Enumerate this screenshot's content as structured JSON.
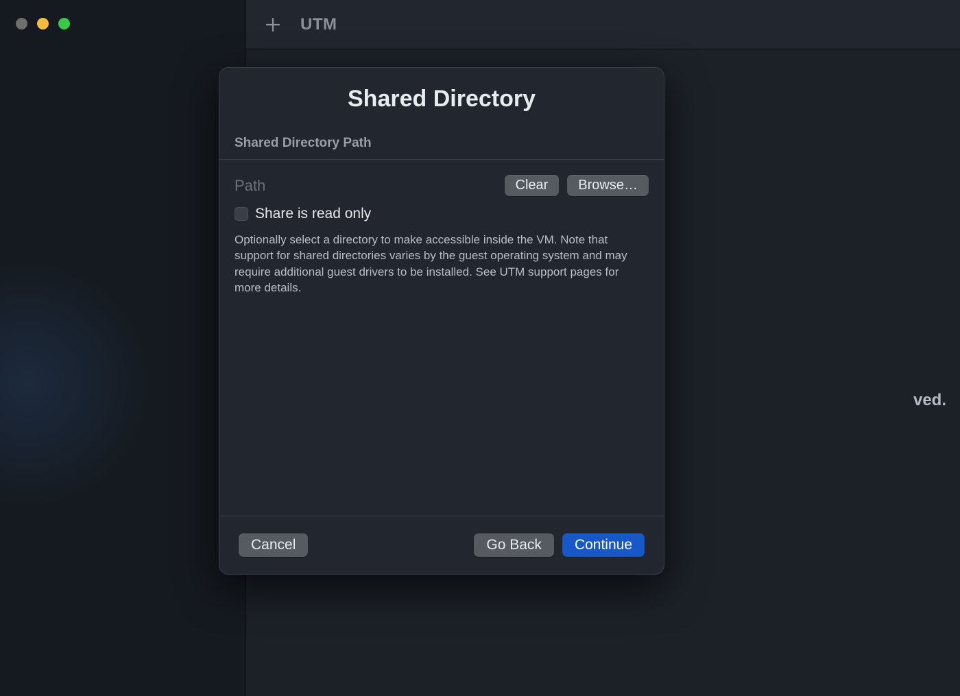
{
  "window": {
    "traffic_lights": {
      "close_color": "#6e6e6e",
      "minimize_color": "#f6bd3b",
      "maximize_color": "#39c84a"
    }
  },
  "toolbar": {
    "app_title": "UTM",
    "add_icon": "plus-icon"
  },
  "background": {
    "partial_text": "ved."
  },
  "dialog": {
    "title": "Shared Directory",
    "section_header": "Shared Directory Path",
    "path_label": "Path",
    "clear_label": "Clear",
    "browse_label": "Browse…",
    "checkbox": {
      "checked": false,
      "label": "Share is read only"
    },
    "description": "Optionally select a directory to make accessible inside the VM. Note that support for shared directories varies by the guest operating system and may require additional guest drivers to be installed. See UTM support pages for more details.",
    "footer": {
      "cancel_label": "Cancel",
      "go_back_label": "Go Back",
      "continue_label": "Continue"
    }
  },
  "colors": {
    "primary_button": "#1757c8",
    "secondary_button": "#565b62",
    "dialog_bg": "#22272f"
  }
}
